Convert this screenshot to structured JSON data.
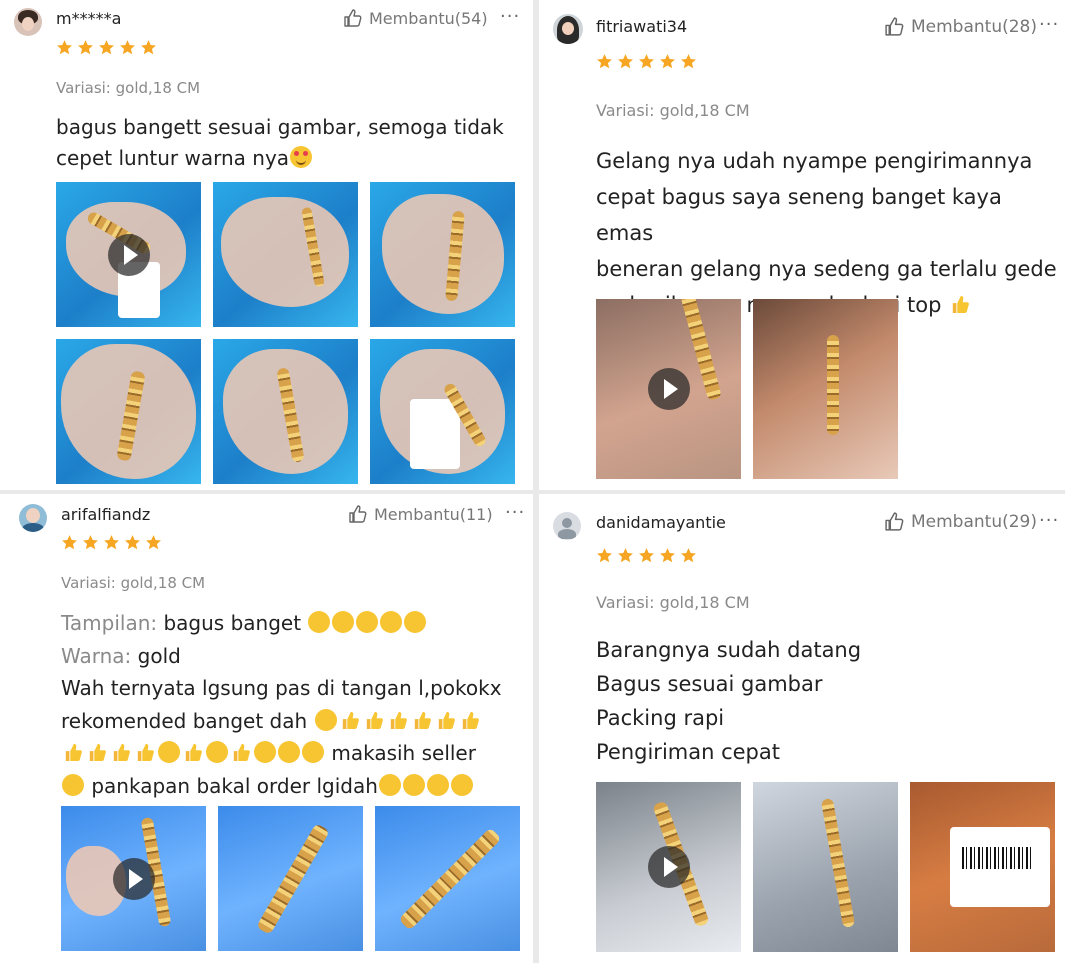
{
  "reviews": [
    {
      "user": "m*****a",
      "helpful": "Membantu(54)",
      "more": "···",
      "rating": 5,
      "variant": "Variasi: gold,18 CM",
      "lines": [
        "bagus bangett sesuai gambar, semoga tidak",
        "cepet luntur warna nya"
      ],
      "photo_count": 6
    },
    {
      "user": "fitriawati34",
      "helpful": "Membantu(28)",
      "more": "···",
      "rating": 5,
      "variant": "Variasi: gold,18 CM",
      "lines": [
        "Gelang nya udah nyampe pengirimannya",
        "cepat bagus saya seneng banget kaya emas",
        "beneran gelang nya sedeng ga terlalu gede",
        "makasih saya mau order lagi top"
      ],
      "photo_count": 2
    },
    {
      "user": "arifalfiandz",
      "helpful": "Membantu(11)",
      "more": "···",
      "rating": 5,
      "variant": "Variasi: gold,18 CM",
      "attr1_label": "Tampilan:",
      "attr1_value": "bagus banget",
      "attr2_label": "Warna:",
      "attr2_value": "gold",
      "lines": [
        "Wah ternyata lgsung pas di tangan l,pokokx",
        "rekomended banget dah",
        "makasih seller",
        "pankapan bakal order lgidah"
      ],
      "photo_count": 3
    },
    {
      "user": "danidamayantie",
      "helpful": "Membantu(29)",
      "more": "···",
      "rating": 5,
      "variant": "Variasi: gold,18 CM",
      "lines": [
        "Barangnya sudah datang",
        "Bagus sesuai gambar",
        "Packing rapi",
        "Pengiriman cepat"
      ],
      "photo_count": 3
    }
  ],
  "colors": {
    "star": "#f6a623",
    "muted": "#8a8a8a",
    "text": "#222222",
    "background": "#e9e9e9"
  },
  "icons": [
    "thumbs-up-icon",
    "more-icon",
    "star-icon",
    "play-icon",
    "avatar-placeholder-icon"
  ]
}
